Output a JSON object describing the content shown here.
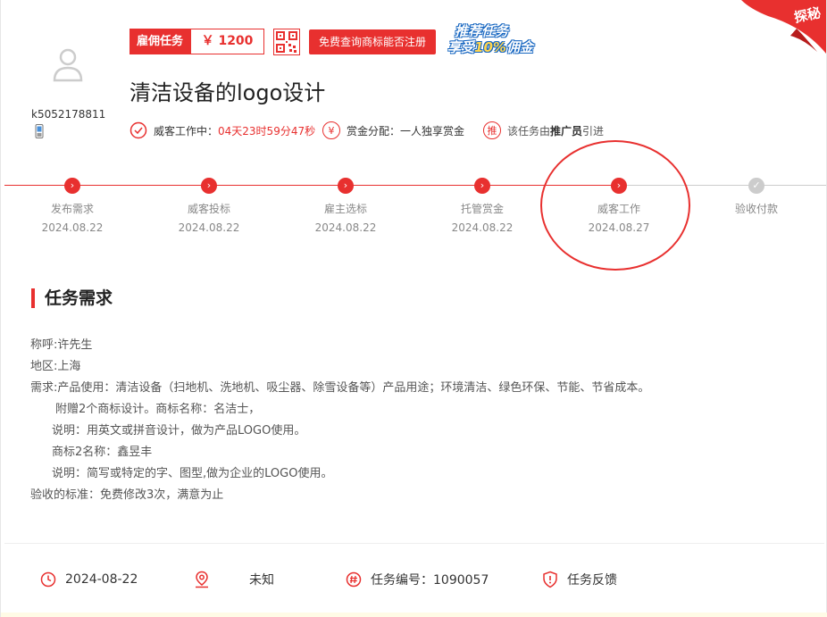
{
  "corner": {
    "text": "探秘"
  },
  "user": {
    "name": "k5052178811"
  },
  "badges": {
    "hire_tag": "雇佣任务",
    "price": "￥ 1200",
    "check_button": "免费查询商标能否注册",
    "promo_line1": "推荐任务",
    "promo_line2_a": "享受",
    "promo_line2_b": "10%",
    "promo_line2_c": "佣金"
  },
  "task": {
    "title": "清洁设备的logo设计"
  },
  "info": {
    "status_label": "威客工作中：",
    "countdown": "04天23时59分47秒",
    "reward_icon": "¥",
    "reward": "赏金分配：一人独享赏金",
    "promoter_icon": "推",
    "promoter_prefix": "该任务由",
    "promoter_bold": "推广员",
    "promoter_suffix": "引进"
  },
  "progress": {
    "steps": [
      {
        "label": "发布需求",
        "date": "2024.08.22",
        "done": true
      },
      {
        "label": "威客投标",
        "date": "2024.08.22",
        "done": true
      },
      {
        "label": "雇主选标",
        "date": "2024.08.22",
        "done": true
      },
      {
        "label": "托管赏金",
        "date": "2024.08.22",
        "done": true
      },
      {
        "label": "威客工作",
        "date": "2024.08.27",
        "done": true
      },
      {
        "label": "验收付款",
        "date": "",
        "done": false
      }
    ]
  },
  "requirements": {
    "title": "任务需求",
    "lines": [
      "称呼:许先生",
      "地区:上海",
      "需求:产品使用：清洁设备（扫地机、洗地机、吸尘器、除雪设备等）产品用途；环境清洁、绿色环保、节能、节省成本。",
      "附赠2个商标设计。商标名称：名洁士，",
      "说明：用英文或拼音设计，做为产品LOGO使用。",
      "商标2名称：鑫昱丰",
      "说明：简写或特定的字、图型,做为企业的LOGO使用。",
      "验收的标准：免费修改3次，满意为止"
    ]
  },
  "footer": {
    "date": "2024-08-22",
    "location": "未知",
    "task_no": "任务编号：1090057",
    "feedback": "任务反馈"
  },
  "colors": {
    "accent": "#e8302f",
    "muted": "#888888"
  }
}
